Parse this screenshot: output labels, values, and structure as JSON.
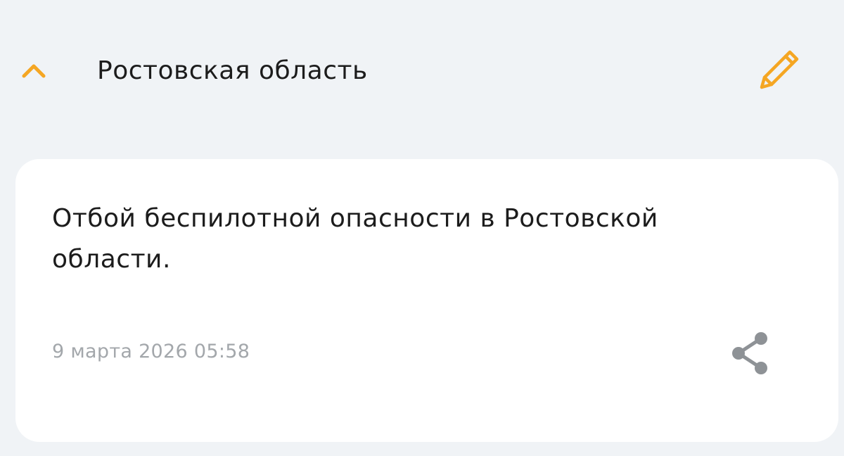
{
  "header": {
    "region_name": "Ростовская область",
    "icons": {
      "collapse": "chevron-up-icon",
      "edit": "pencil-icon"
    }
  },
  "alert": {
    "message": "Отбой беспилотной опасности в Ростовской области.",
    "timestamp": "9 марта 2026 05:58",
    "icons": {
      "share": "share-icon"
    }
  },
  "colors": {
    "accent": "#f5a623",
    "background": "#f0f3f6",
    "card": "#ffffff",
    "text": "#1c1c1c",
    "muted": "#a3a7ab",
    "share_icon": "#8e9296"
  }
}
